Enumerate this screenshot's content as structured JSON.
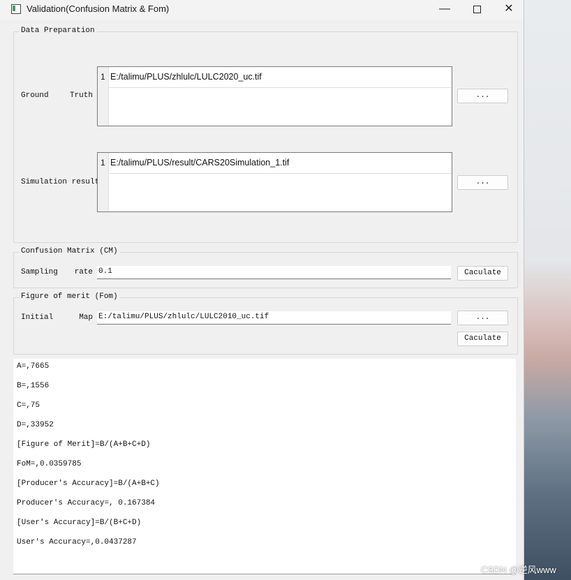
{
  "window": {
    "title": "Validation(Confusion Matrix & Fom)"
  },
  "data_prep": {
    "group_title": "Data Preparation",
    "ground_truth": {
      "label_words": [
        "Ground",
        "Truth"
      ],
      "line_number": "1",
      "path": "E:/talimu/PLUS/zhlulc/LULC2020_uc.tif",
      "browse_label": "..."
    },
    "simulation": {
      "label": "Simulation result",
      "line_number": "1",
      "path": "E:/talimu/PLUS/result/CARS20Simulation_1.tif",
      "browse_label": "..."
    }
  },
  "confusion_matrix": {
    "group_title": "Confusion Matrix (CM)",
    "label_words": [
      "Sampling",
      "rate"
    ],
    "sampling_rate": "0.1",
    "calculate_label": "Caculate"
  },
  "fom": {
    "group_title": "Figure of merit (Fom)",
    "label_words": [
      "Initial",
      "Map"
    ],
    "path": "E:/talimu/PLUS/zhlulc/LULC2010_uc.tif",
    "browse_label": "...",
    "calculate_label": "Caculate"
  },
  "output": {
    "lines": [
      "A=,7665",
      "B=,1556",
      "C=,75",
      "D=,33952",
      "[Figure of Merit]=B/(A+B+C+D)",
      "FoM=,0.0359785",
      "[Producer's Accuracy]=B/(A+B+C)",
      "Producer's Accuracy=, 0.167384",
      "[User's Accuracy]=B/(B+C+D)",
      "User's Accuracy=,0.0437287"
    ]
  },
  "watermark": "CSDN @逆风www"
}
